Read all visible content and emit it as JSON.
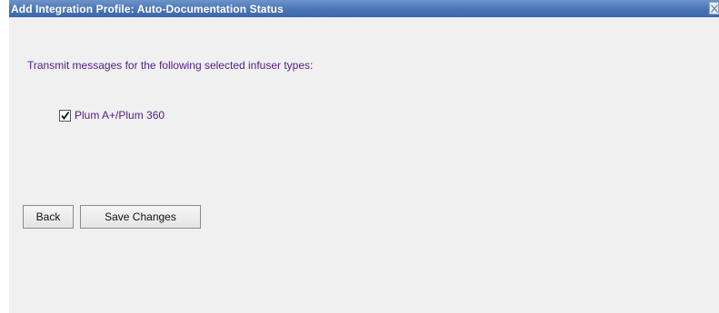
{
  "dialog": {
    "title": "Add Integration Profile: Auto-Documentation Status",
    "close_icon": "close-icon"
  },
  "content": {
    "instructions": "Transmit messages for the following selected infuser types:",
    "infuser_options": [
      {
        "label": "Plum A+/Plum 360",
        "checked": true
      }
    ]
  },
  "buttons": {
    "back_label": "Back",
    "save_label": "Save Changes"
  },
  "colors": {
    "titlebar": "#4a74b6",
    "title_text": "#ffffff",
    "body_background": "#f0f0f0",
    "label_text": "#551a8b"
  }
}
